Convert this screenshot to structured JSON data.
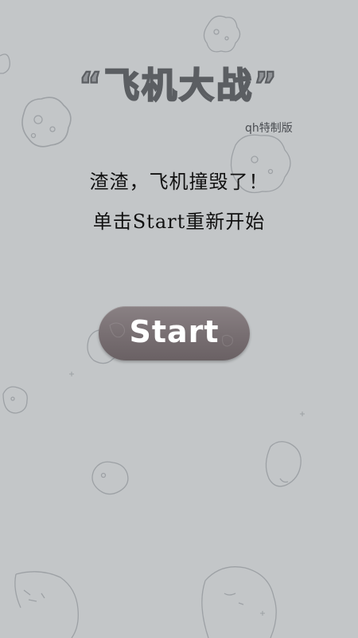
{
  "game": {
    "logo_text": "“飞机大战”",
    "edition": "qh特制版"
  },
  "messages": {
    "line1": "渣渣，飞机撞毁了！",
    "line2": "单击Start重新开始"
  },
  "start_button": {
    "label": "Start"
  }
}
